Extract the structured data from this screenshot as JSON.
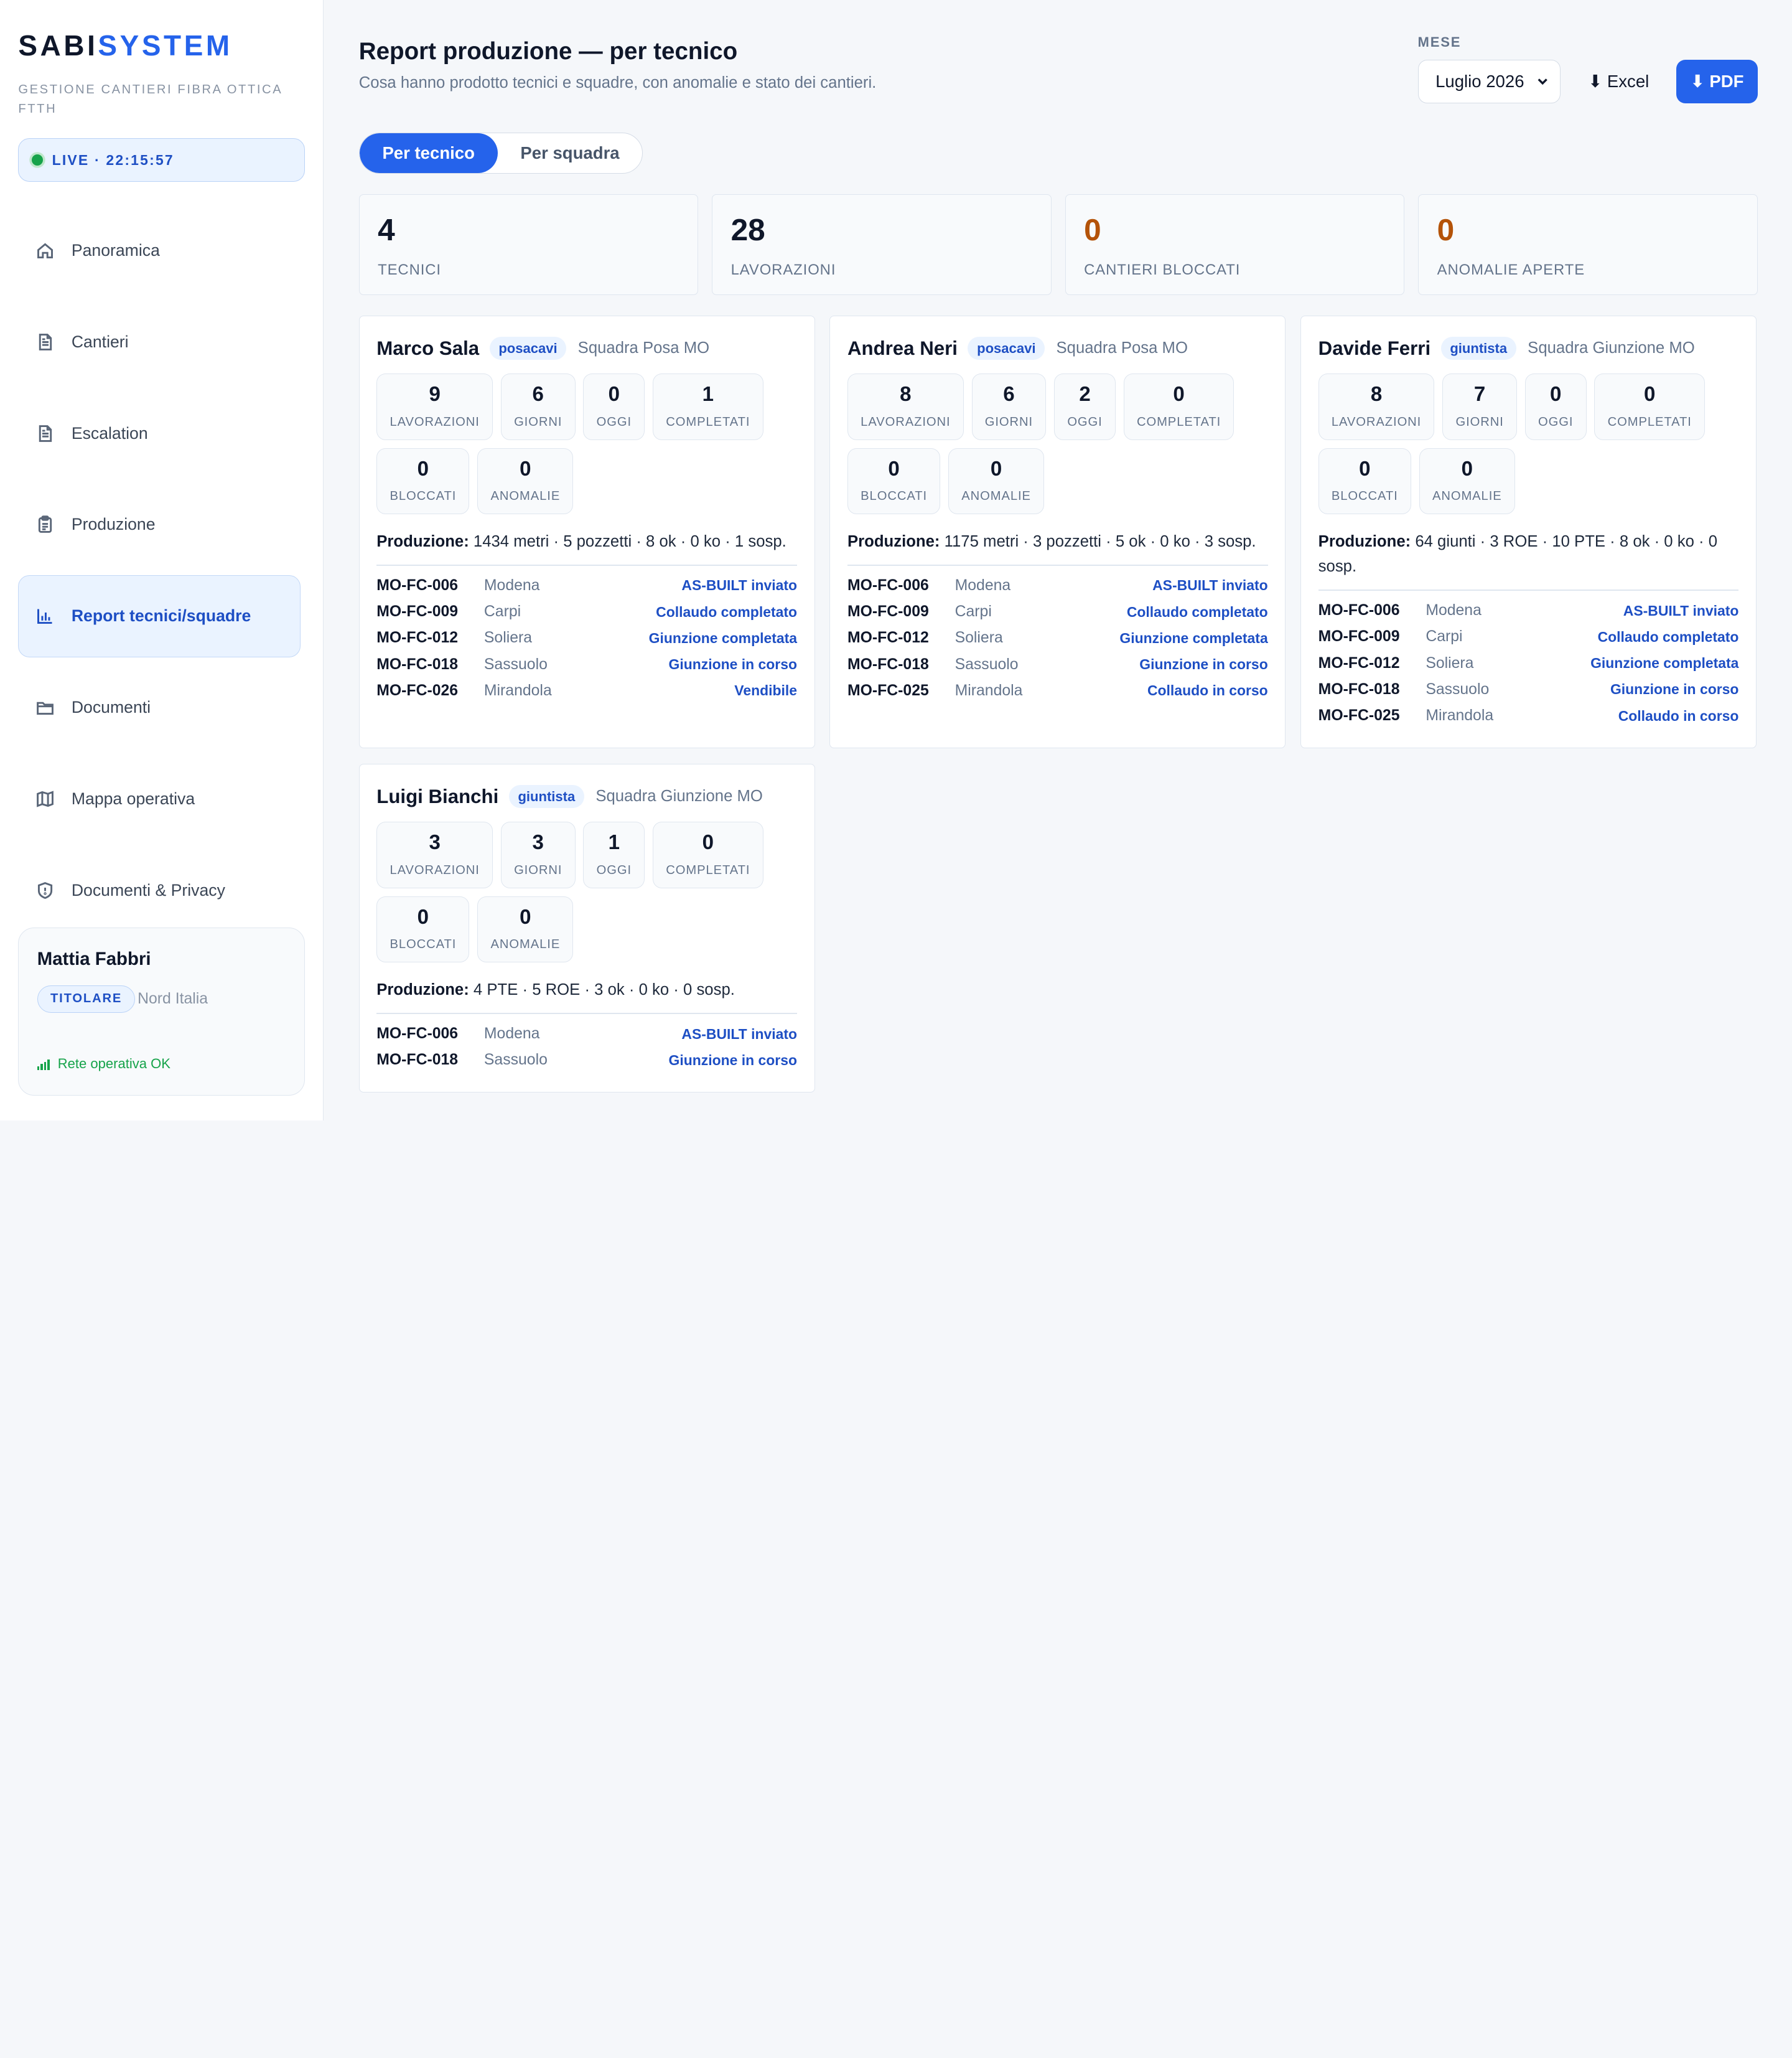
{
  "brand": {
    "part1": "SABI",
    "part2": "SYSTEM",
    "subtitle": "GESTIONE CANTIERI FIBRA OTTICA FTTH"
  },
  "live": {
    "label": "LIVE · 22:15:57"
  },
  "nav": [
    {
      "label": "Panoramica",
      "icon": "home-icon"
    },
    {
      "label": "Cantieri",
      "icon": "document-icon"
    },
    {
      "label": "Escalation",
      "icon": "document-icon"
    },
    {
      "label": "Produzione",
      "icon": "clipboard-icon"
    },
    {
      "label": "Report tecnici/squadre",
      "icon": "bar-chart-icon",
      "active": true
    },
    {
      "label": "Documenti",
      "icon": "folder-icon"
    },
    {
      "label": "Mappa operativa",
      "icon": "map-icon"
    },
    {
      "label": "Documenti & Privacy",
      "icon": "shield-icon"
    }
  ],
  "user": {
    "name": "Mattia Fabbri",
    "role": "TITOLARE",
    "region": "Nord Italia",
    "network": "Rete operativa OK"
  },
  "header": {
    "title": "Report produzione — per tecnico",
    "subtitle": "Cosa hanno prodotto tecnici e squadre, con anomalie e stato dei cantieri.",
    "month_label": "MESE",
    "month_value": "Luglio 2026",
    "excel_label": "⬇ Excel",
    "pdf_label": "⬇ PDF"
  },
  "tabs": [
    {
      "label": "Per tecnico",
      "active": true
    },
    {
      "label": "Per squadra",
      "active": false
    }
  ],
  "stats": [
    {
      "value": "4",
      "label": "TECNICI",
      "warn": false
    },
    {
      "value": "28",
      "label": "LAVORAZIONI",
      "warn": false
    },
    {
      "value": "0",
      "label": "CANTIERI BLOCCATI",
      "warn": true
    },
    {
      "value": "0",
      "label": "ANOMALIE APERTE",
      "warn": true
    }
  ],
  "technicians": [
    {
      "name": "Marco Sala",
      "role": "posacavi",
      "team": "Squadra Posa MO",
      "metrics": [
        {
          "value": "9",
          "label": "LAVORAZIONI"
        },
        {
          "value": "6",
          "label": "GIORNI"
        },
        {
          "value": "0",
          "label": "OGGI"
        },
        {
          "value": "1",
          "label": "COMPLETATI"
        },
        {
          "value": "0",
          "label": "BLOCCATI"
        },
        {
          "value": "0",
          "label": "ANOMALIE"
        }
      ],
      "production_label": "Produzione:",
      "production": "1434 metri · 5 pozzetti · 8 ok · 0 ko · 1 sosp.",
      "sites": [
        {
          "code": "MO-FC-006",
          "city": "Modena",
          "status": "AS-BUILT inviato"
        },
        {
          "code": "MO-FC-009",
          "city": "Carpi",
          "status": "Collaudo completato"
        },
        {
          "code": "MO-FC-012",
          "city": "Soliera",
          "status": "Giunzione completata"
        },
        {
          "code": "MO-FC-018",
          "city": "Sassuolo",
          "status": "Giunzione in corso"
        },
        {
          "code": "MO-FC-026",
          "city": "Mirandola",
          "status": "Vendibile"
        }
      ]
    },
    {
      "name": "Andrea Neri",
      "role": "posacavi",
      "team": "Squadra Posa MO",
      "metrics": [
        {
          "value": "8",
          "label": "LAVORAZIONI"
        },
        {
          "value": "6",
          "label": "GIORNI"
        },
        {
          "value": "2",
          "label": "OGGI"
        },
        {
          "value": "0",
          "label": "COMPLETATI"
        },
        {
          "value": "0",
          "label": "BLOCCATI"
        },
        {
          "value": "0",
          "label": "ANOMALIE"
        }
      ],
      "production_label": "Produzione:",
      "production": "1175 metri · 3 pozzetti · 5 ok · 0 ko · 3 sosp.",
      "sites": [
        {
          "code": "MO-FC-006",
          "city": "Modena",
          "status": "AS-BUILT inviato"
        },
        {
          "code": "MO-FC-009",
          "city": "Carpi",
          "status": "Collaudo completato"
        },
        {
          "code": "MO-FC-012",
          "city": "Soliera",
          "status": "Giunzione completata"
        },
        {
          "code": "MO-FC-018",
          "city": "Sassuolo",
          "status": "Giunzione in corso"
        },
        {
          "code": "MO-FC-025",
          "city": "Mirandola",
          "status": "Collaudo in corso"
        }
      ]
    },
    {
      "name": "Davide Ferri",
      "role": "giuntista",
      "team": "Squadra Giunzione MO",
      "metrics": [
        {
          "value": "8",
          "label": "LAVORAZIONI"
        },
        {
          "value": "7",
          "label": "GIORNI"
        },
        {
          "value": "0",
          "label": "OGGI"
        },
        {
          "value": "0",
          "label": "COMPLETATI"
        },
        {
          "value": "0",
          "label": "BLOCCATI"
        },
        {
          "value": "0",
          "label": "ANOMALIE"
        }
      ],
      "production_label": "Produzione:",
      "production": "64 giunti · 3 ROE · 10 PTE · 8 ok · 0 ko · 0 sosp.",
      "sites": [
        {
          "code": "MO-FC-006",
          "city": "Modena",
          "status": "AS-BUILT inviato"
        },
        {
          "code": "MO-FC-009",
          "city": "Carpi",
          "status": "Collaudo completato"
        },
        {
          "code": "MO-FC-012",
          "city": "Soliera",
          "status": "Giunzione completata"
        },
        {
          "code": "MO-FC-018",
          "city": "Sassuolo",
          "status": "Giunzione in corso"
        },
        {
          "code": "MO-FC-025",
          "city": "Mirandola",
          "status": "Collaudo in corso"
        }
      ]
    },
    {
      "name": "Luigi Bianchi",
      "role": "giuntista",
      "team": "Squadra Giunzione MO",
      "metrics": [
        {
          "value": "3",
          "label": "LAVORAZIONI"
        },
        {
          "value": "3",
          "label": "GIORNI"
        },
        {
          "value": "1",
          "label": "OGGI"
        },
        {
          "value": "0",
          "label": "COMPLETATI"
        },
        {
          "value": "0",
          "label": "BLOCCATI"
        },
        {
          "value": "0",
          "label": "ANOMALIE"
        }
      ],
      "production_label": "Produzione:",
      "production": "4 PTE · 5 ROE · 3 ok · 0 ko · 0 sosp.",
      "sites": [
        {
          "code": "MO-FC-006",
          "city": "Modena",
          "status": "AS-BUILT inviato"
        },
        {
          "code": "MO-FC-018",
          "city": "Sassuolo",
          "status": "Giunzione in corso"
        }
      ]
    }
  ]
}
